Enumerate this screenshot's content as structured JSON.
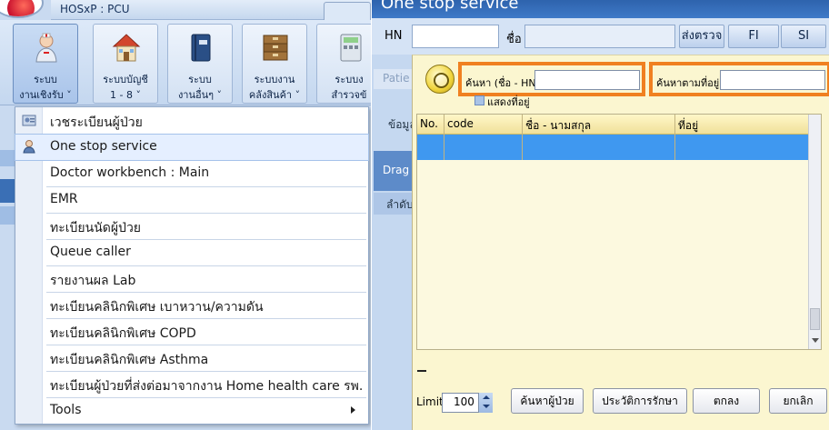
{
  "app": {
    "tab_title": "HOSxP : PCU"
  },
  "ribbon": {
    "buttons": [
      {
        "label": "ระบบ\nงานเชิงรับ ˅",
        "icon": "nurse-icon"
      },
      {
        "label": "ระบบบัญชี\n1 - 8 ˅",
        "icon": "house-icon"
      },
      {
        "label": "ระบบ\nงานอื่นๆ ˅",
        "icon": "book-icon"
      },
      {
        "label": "ระบบงาน\nคลังสินค้า ˅",
        "icon": "boxes-icon"
      },
      {
        "label": "ระบบง\nสำรวจข้",
        "icon": "calculator-icon"
      }
    ]
  },
  "menu": {
    "items": [
      "เวชระเบียนผู้ป่วย",
      "One stop service",
      "Doctor workbench : Main",
      "EMR",
      "ทะเบียนนัดผู้ป่วย",
      "Queue caller",
      "รายงานผล Lab",
      "ทะเบียนคลินิกพิเศษ เบาหวาน/ความดัน",
      "ทะเบียนคลินิกพิเศษ COPD",
      "ทะเบียนคลินิกพิเศษ Asthma",
      "ทะเบียนผู้ป่วยที่ส่งต่อมาจากงาน Home health care รพ.",
      "Tools"
    ]
  },
  "window": {
    "title": "One stop service"
  },
  "top_bar": {
    "hn_label": "HN",
    "name_label": "ชื่อ",
    "send_button": "ส่งตรวจ",
    "fi_button": "FI",
    "si_button": "SI"
  },
  "side_tabs": [
    "Patie",
    "ข้อมูล",
    "Drag",
    "ลำดับ"
  ],
  "dialog": {
    "search_name_label": "ค้นหา (ชื่อ - HN)",
    "search_address_label": "ค้นหาตามที่อยู่",
    "show_address_label": "แสดงที่อยู่",
    "columns": [
      "No.",
      "code",
      "ชื่อ - นามสกุล",
      "ที่อยู่"
    ],
    "limit_label": "Limit",
    "limit_value": "100",
    "buttons": {
      "search_patient": "ค้นหาผู้ป่วย",
      "history": "ประวัติการรักษา",
      "ok": "ตกลง",
      "cancel": "ยกเลิก"
    }
  },
  "colors": {
    "highlight": "#f08020",
    "selected_row": "#3f98f0",
    "title_bar": "#3f7ac8",
    "dialog_bg": "#fbf6d0"
  }
}
